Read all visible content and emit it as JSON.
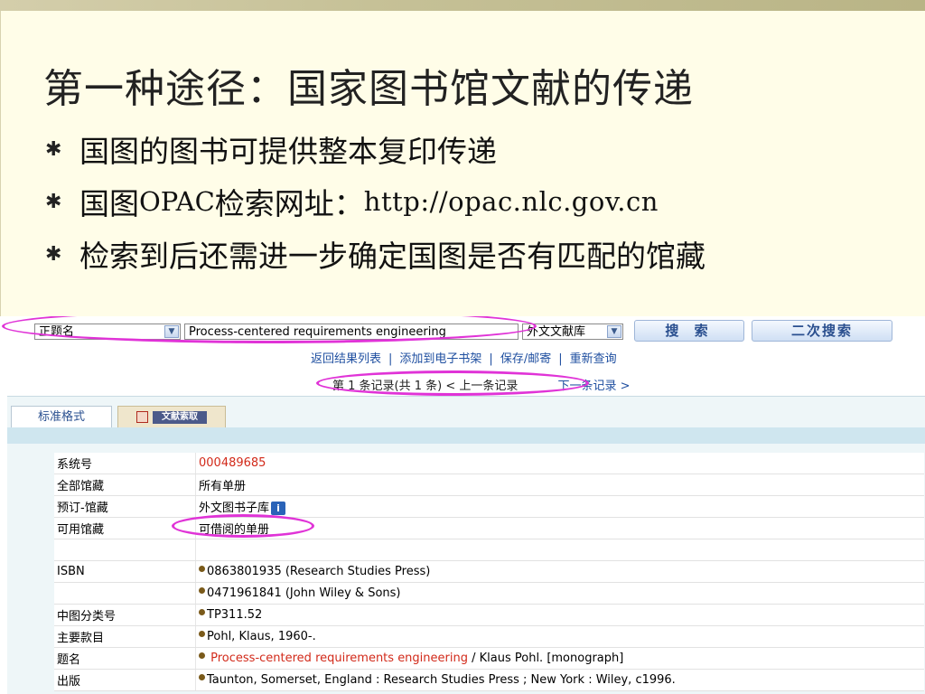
{
  "slide": {
    "title": "第一种途径：国家图书馆文献的传递",
    "bullets": [
      {
        "text": "国图的图书可提供整本复印传递"
      },
      {
        "prefix": "国图",
        "mono": "OPAC",
        "mid": "检索网址：",
        "url": "http://opac.nlc.gov.cn"
      },
      {
        "text": "检索到后还需进一步确定国图是否有匹配的馆藏"
      }
    ],
    "bullet_glyph": "✱"
  },
  "search": {
    "field_select": "正题名",
    "query": "Process-centered requirements engineering",
    "db_select": "外文文献库",
    "search_button": "搜 索",
    "research_button": "二次搜索"
  },
  "links": {
    "back": "返回结果列表",
    "add_shelf": "添加到电子书架",
    "save_mail": "保存/邮寄",
    "new_query": "重新查询",
    "sep": "|"
  },
  "pager": {
    "current": "第 1 条记录(共 1 条)",
    "prev": "< 上一条记录",
    "next": "下一条记录 >"
  },
  "tabs": {
    "standard": "标准格式",
    "doc_request": "文献索取"
  },
  "record": [
    {
      "key": "系统号",
      "value": "000489685"
    },
    {
      "key": "全部馆藏",
      "value": "所有单册"
    },
    {
      "key": "预订-馆藏",
      "value": "外文图书子库"
    },
    {
      "key": "可用馆藏",
      "value": "可借阅的单册"
    },
    {
      "key": "",
      "value": ""
    },
    {
      "key": "ISBN",
      "value": "0863801935 (Research Studies Press)"
    },
    {
      "key": "",
      "value": "0471961841 (John Wiley & Sons)"
    },
    {
      "key": "中图分类号",
      "value": "TP311.52"
    },
    {
      "key": "主要款目",
      "value": "Pohl, Klaus, 1960-."
    },
    {
      "key": "题名",
      "title_red": "Process-centered  requirements  engineering",
      "title_rest": " / Klaus Pohl. [monograph]"
    },
    {
      "key": "出版",
      "value": "Taunton, Somerset, England : Research Studies Press ; New York : Wiley, c1996."
    }
  ],
  "info_icon": "i",
  "colors": {
    "highlight_oval": "#e033d7",
    "link": "#1f4fa0",
    "red_text": "#d22a1a"
  }
}
